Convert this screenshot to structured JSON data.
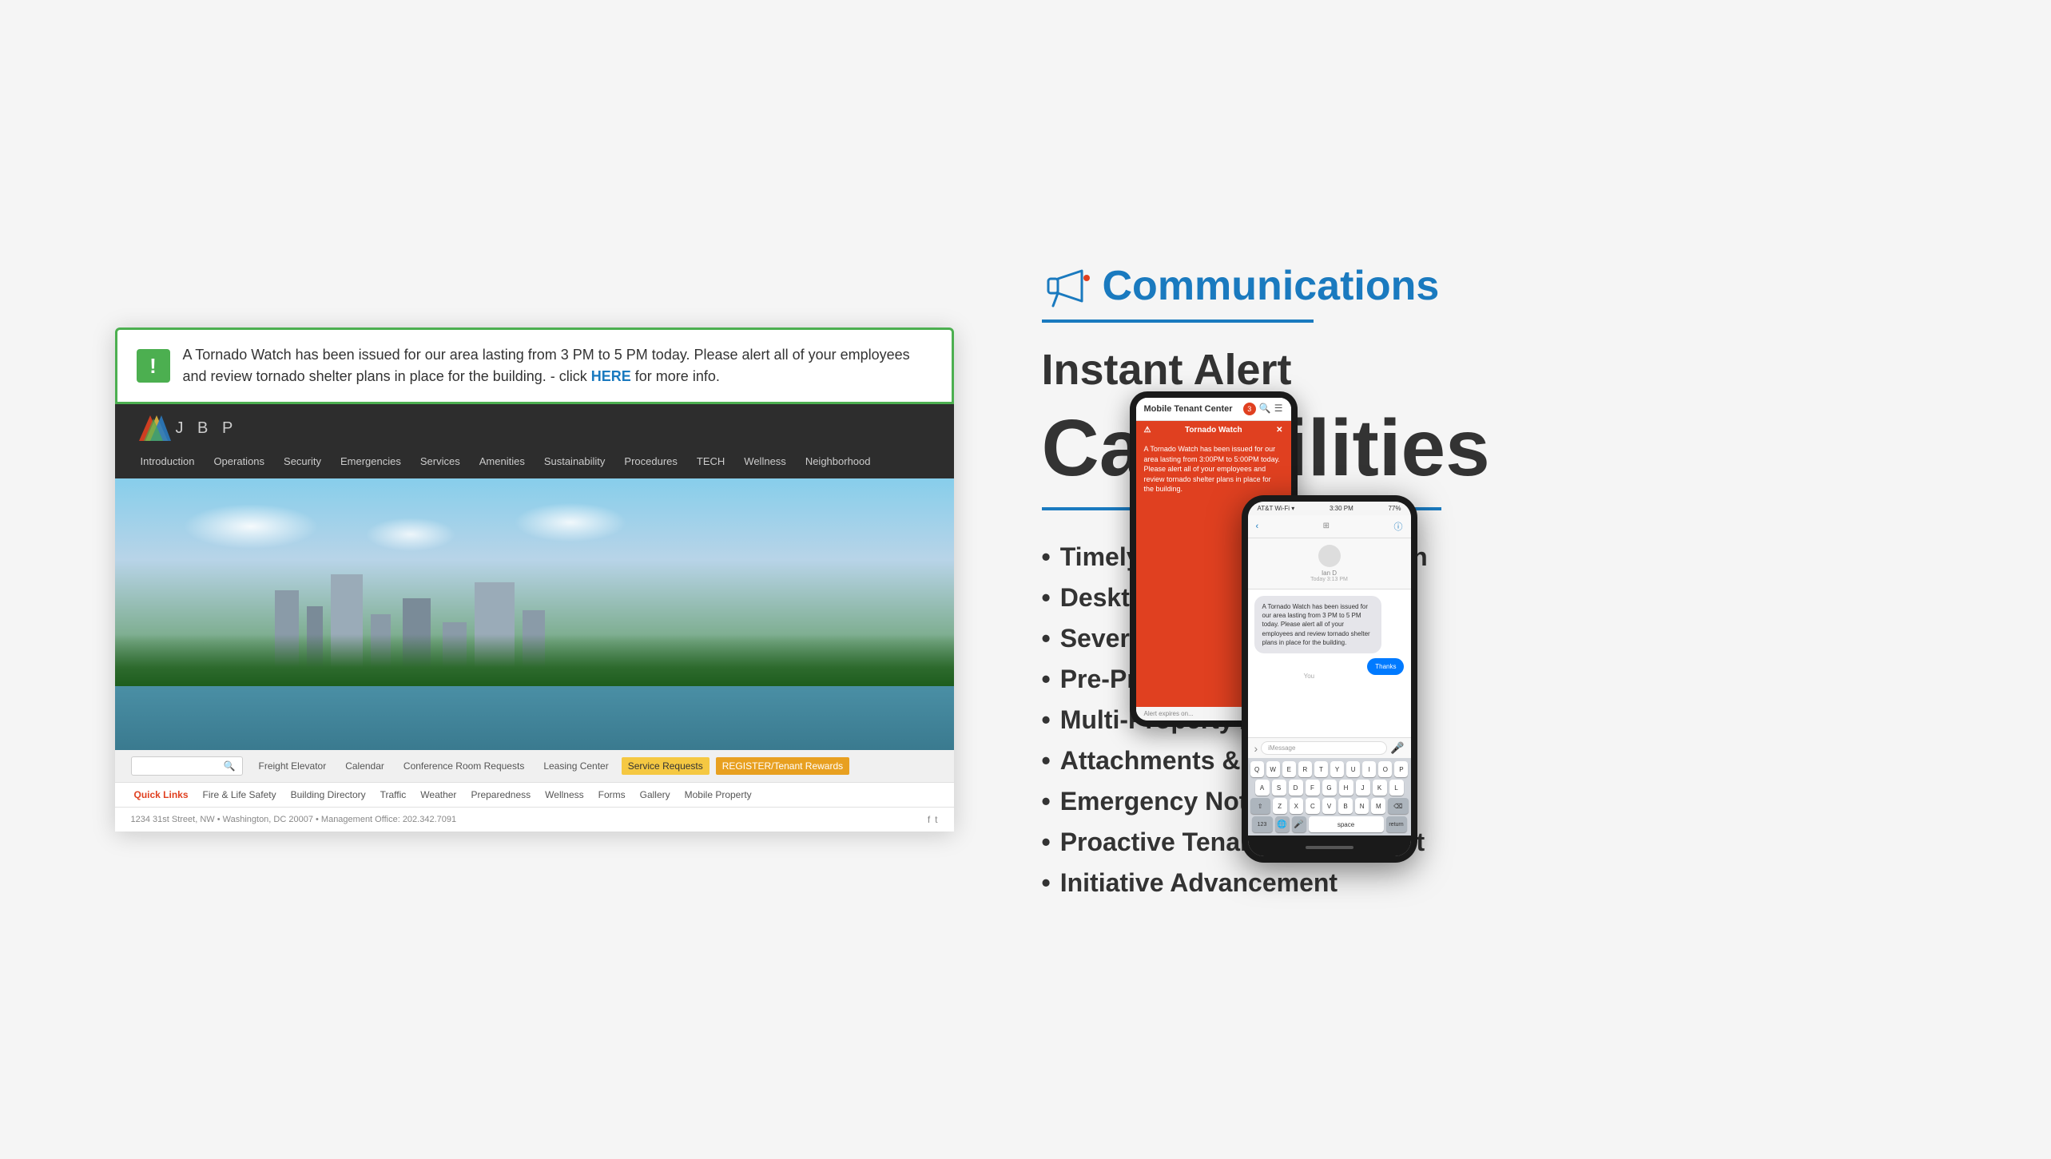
{
  "page": {
    "background": "#f5f5f5"
  },
  "alert": {
    "icon": "!",
    "text": "A Tornado Watch has been issued for our area lasting from 3 PM to 5 PM today. Please alert all of your employees and review tornado shelter plans in place for the building. - click ",
    "link_text": "HERE",
    "link_suffix": " for more info."
  },
  "site": {
    "logo_text": "J B P",
    "nav_items": [
      "Introduction",
      "Operations",
      "Security",
      "Emergencies",
      "Services",
      "Amenities",
      "Sustainability",
      "Procedures",
      "TECH",
      "Wellness",
      "Neighborhood"
    ],
    "bottom_links": [
      "Freight Elevator",
      "Calendar",
      "Conference Room Requests",
      "Leasing Center",
      "Service Requests",
      "REGISTER/Tenant Rewards"
    ],
    "quicklinks": [
      "Quick Links",
      "Fire & Life Safety",
      "Building Directory",
      "Traffic",
      "Weather",
      "Preparedness",
      "Wellness",
      "Forms",
      "Gallery",
      "Mobile Property"
    ],
    "footer_text": "1234 31st Street, NW • Washington, DC 20007 • Management Office: 202.342.7091"
  },
  "phone1": {
    "header_title": "Mobile Tenant Center",
    "badge": "3",
    "alert_title": "Tornado Watch",
    "alert_body": "A Tornado Watch has been issued for our area lasting from 3:00PM to 5:00PM today. Please alert all of your employees and review tornado shelter plans in place for the building.",
    "expires_text": "Alert expires on..."
  },
  "phone2": {
    "status_time": "3:30 PM",
    "status_signal": "AT&T Wi-Fi ▾",
    "status_battery": "77%",
    "contact_name": "Ian D",
    "contact_time": "Today 3:13 PM",
    "message_body": "A Tornado Watch has been issued for our area lasting from 3 PM to 5 PM today. Please alert all of your employees and review tornado shelter plans in place for the building.",
    "reply_you": "You",
    "reply_text": "Thanks",
    "input_placeholder": "iMessage",
    "keyboard_rows": [
      [
        "Q",
        "W",
        "E",
        "R",
        "T",
        "Y",
        "U",
        "I",
        "O",
        "P"
      ],
      [
        "A",
        "S",
        "D",
        "F",
        "G",
        "H",
        "J",
        "K",
        "L"
      ],
      [
        "Z",
        "X",
        "C",
        "V",
        "B",
        "N",
        "M"
      ],
      [
        "123",
        "space",
        "return"
      ]
    ]
  },
  "right": {
    "comm_label": "Communications",
    "instant_alert": "Instant Alert",
    "capabilities": "Capabilities",
    "items": [
      "Timely & Effective Notification",
      "Desktop/Mobile/Email/Text",
      "Severity/Situational Priorities",
      "Pre-Program Distribution",
      "Multi-Property / Portfolio",
      "Attachments & Links",
      "Emergency Notification",
      "Proactive Tenant Engagement",
      "Initiative Advancement"
    ]
  }
}
